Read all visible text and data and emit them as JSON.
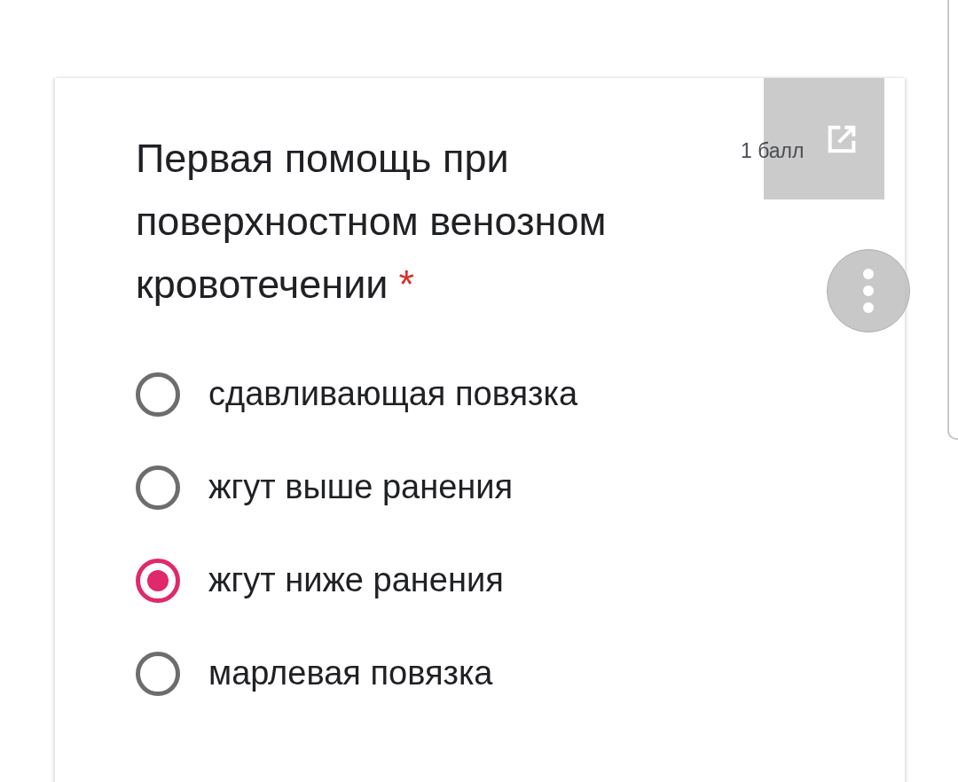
{
  "question": {
    "title": "Первая помощь при поверхностном венозном кровотечении",
    "required": true,
    "required_mark": "*",
    "points": "1 балл"
  },
  "options": [
    {
      "label": "сдавливающая повязка",
      "selected": false
    },
    {
      "label": "жгут выше ранения",
      "selected": false
    },
    {
      "label": "жгут ниже ранения",
      "selected": true
    },
    {
      "label": "марлевая повязка",
      "selected": false
    }
  ]
}
